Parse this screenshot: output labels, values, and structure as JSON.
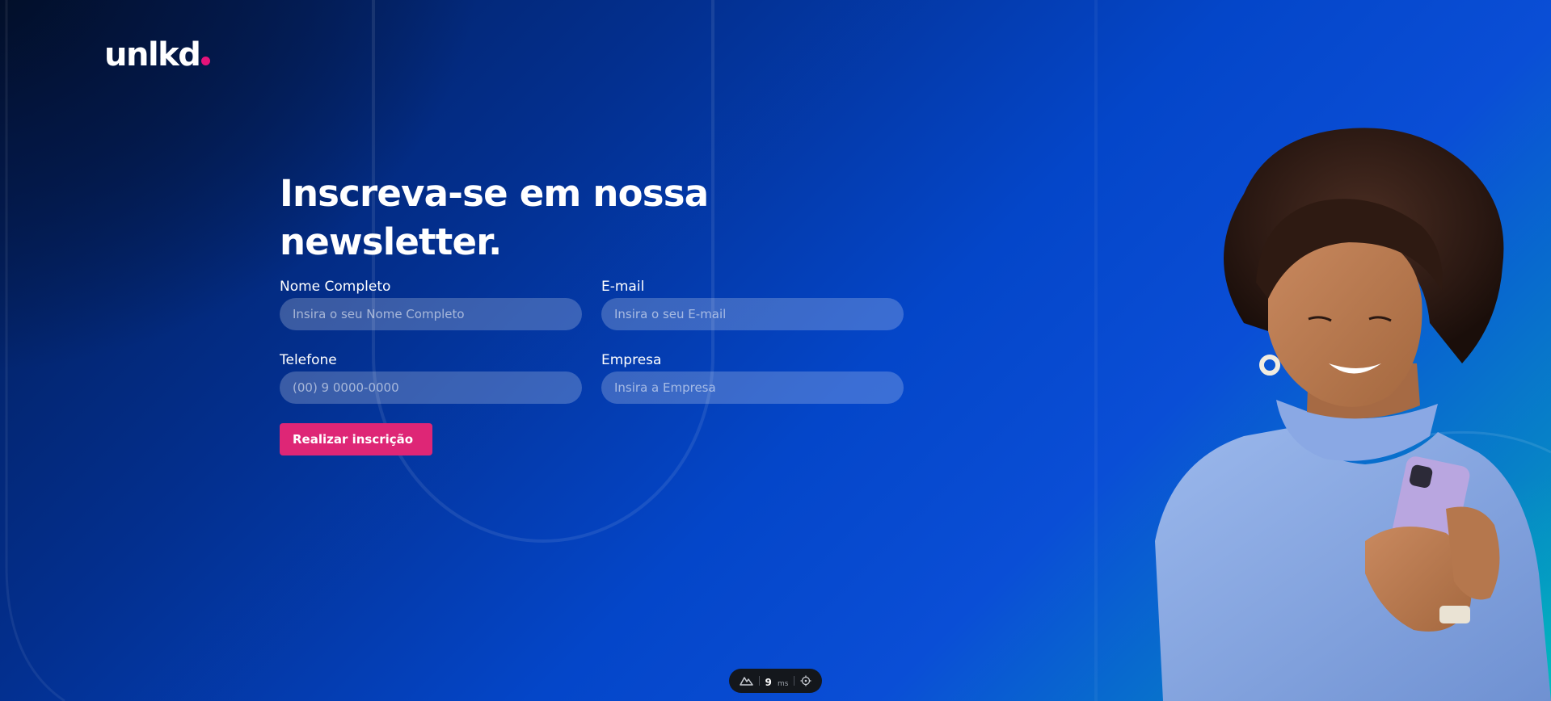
{
  "brand": {
    "name": "unlkd",
    "accent_color": "#e5137a"
  },
  "form": {
    "title": "Inscreva-se em nossa newsletter.",
    "fields": {
      "name": {
        "label": "Nome Completo",
        "placeholder": "Insira o seu Nome Completo",
        "value": ""
      },
      "email": {
        "label": "E-mail",
        "placeholder": "Insira o seu E-mail",
        "value": ""
      },
      "phone": {
        "label": "Telefone",
        "placeholder": "(00) 9 0000-0000",
        "value": ""
      },
      "company": {
        "label": "Empresa",
        "placeholder": "Insira a Empresa",
        "value": ""
      }
    },
    "submit_label": "Realizar inscrição",
    "submit_color": "#de2676"
  },
  "dev_toolbar": {
    "logo_icon": "nuxt-mountain-icon",
    "render_time": "9",
    "render_unit": "ms",
    "inspect_icon": "crosshair-icon"
  },
  "hero": {
    "image_icon": "woman-smiling-with-phone-photo"
  }
}
